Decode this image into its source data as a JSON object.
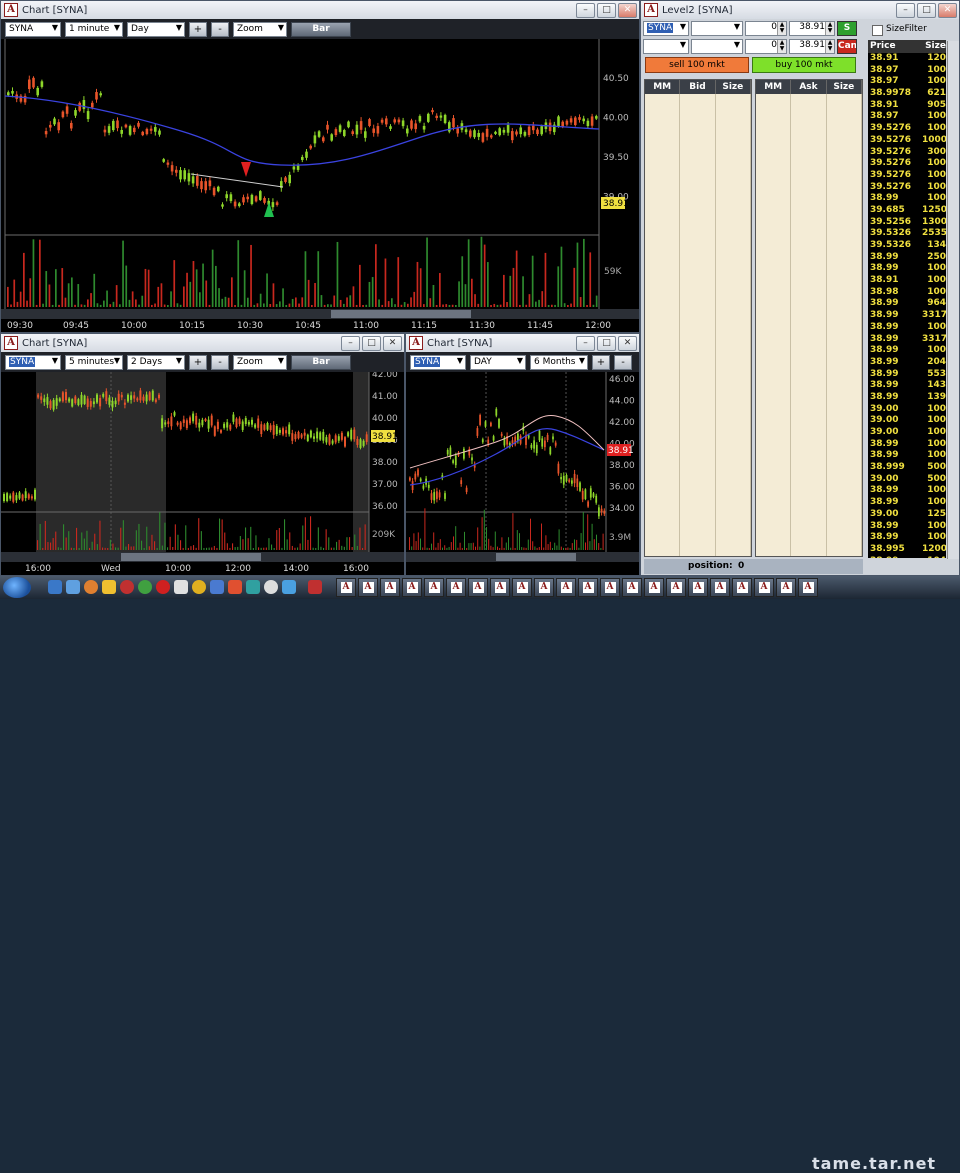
{
  "chart_top": {
    "title": "Chart [SYNA]",
    "symbol": "SYNA",
    "interval": "1 minute",
    "range": "Day",
    "zoom": "Zoom",
    "bar_button": "Bar",
    "plus": "+",
    "minus": "-",
    "price_labels": [
      "40.50",
      "40.00",
      "39.50",
      "39.00"
    ],
    "last_price": "38.91",
    "volume_label": "59K",
    "time_labels": [
      "09:30",
      "09:45",
      "10:00",
      "10:15",
      "10:30",
      "10:45",
      "11:00",
      "11:15",
      "11:30",
      "11:45",
      "12:00"
    ]
  },
  "chart_left": {
    "title": "Chart [SYNA]",
    "symbol": "SYNA",
    "interval": "5 minutes",
    "range": "2 Days",
    "zoom": "Zoom",
    "bar_button": "Bar",
    "plus": "+",
    "minus": "-",
    "price_labels": [
      "42.00",
      "41.00",
      "40.00",
      "39.00",
      "38.00",
      "37.00",
      "36.00"
    ],
    "last_price": "38.91",
    "volume_label": "209K",
    "time_labels": [
      "16:00",
      "Wed",
      "10:00",
      "12:00",
      "14:00",
      "16:00"
    ]
  },
  "chart_right": {
    "title": "Chart [SYNA]",
    "symbol": "SYNA",
    "interval": "DAY",
    "range": "6 Months",
    "plus": "+",
    "minus": "-",
    "price_labels": [
      "46.00",
      "44.00",
      "42.00",
      "40.00",
      "38.00",
      "36.00",
      "34.00"
    ],
    "last_price": "38.91",
    "volume_label": "3.9M"
  },
  "level2": {
    "title": "Level2 [SYNA]",
    "symbol": "SYNA",
    "qty1": "0",
    "price1": "38.91",
    "qty2": "0",
    "price2": "38.91",
    "cancel_label": "Can",
    "sell_button": "sell 100 mkt",
    "buy_button": "buy 100 mkt",
    "bid_headers": [
      "MM",
      "Bid",
      "Size"
    ],
    "ask_headers": [
      "MM",
      "Ask",
      "Size"
    ],
    "position_label": "position:",
    "position_value": "0",
    "colors": {
      "sell": "#f07a3a",
      "buy": "#7ee02a",
      "green_btn": "#2ea02e",
      "red_btn": "#c8281e"
    }
  },
  "time_sales": {
    "sizefilter_label": "SizeFilter",
    "headers": {
      "price": "Price",
      "size": "Size"
    },
    "rows": [
      [
        "38.91",
        "120"
      ],
      [
        "38.97",
        "100"
      ],
      [
        "38.97",
        "100"
      ],
      [
        "38.9978",
        "621"
      ],
      [
        "38.91",
        "905"
      ],
      [
        "38.97",
        "100"
      ],
      [
        "39.5276",
        "100"
      ],
      [
        "39.5276",
        "1000"
      ],
      [
        "39.5276",
        "300"
      ],
      [
        "39.5276",
        "100"
      ],
      [
        "39.5276",
        "100"
      ],
      [
        "39.5276",
        "100"
      ],
      [
        "38.99",
        "100"
      ],
      [
        "39.685",
        "1250"
      ],
      [
        "39.5256",
        "1300"
      ],
      [
        "39.5326",
        "2535"
      ],
      [
        "39.5326",
        "134"
      ],
      [
        "38.99",
        "250"
      ],
      [
        "38.99",
        "100"
      ],
      [
        "38.91",
        "100"
      ],
      [
        "38.98",
        "100"
      ],
      [
        "38.99",
        "964"
      ],
      [
        "38.99",
        "3317"
      ],
      [
        "38.99",
        "100"
      ],
      [
        "38.99",
        "3317"
      ],
      [
        "38.99",
        "100"
      ],
      [
        "38.99",
        "204"
      ],
      [
        "38.99",
        "553"
      ],
      [
        "38.99",
        "143"
      ],
      [
        "38.99",
        "139"
      ],
      [
        "39.00",
        "100"
      ],
      [
        "39.00",
        "100"
      ],
      [
        "39.00",
        "100"
      ],
      [
        "38.99",
        "100"
      ],
      [
        "38.99",
        "100"
      ],
      [
        "38.999",
        "500"
      ],
      [
        "39.00",
        "500"
      ],
      [
        "38.99",
        "100"
      ],
      [
        "38.99",
        "100"
      ],
      [
        "39.00",
        "125"
      ],
      [
        "38.99",
        "100"
      ],
      [
        "38.99",
        "100"
      ],
      [
        "38.995",
        "1200"
      ],
      [
        "38.99",
        "104"
      ]
    ]
  },
  "watermark": "tame.tar.net"
}
